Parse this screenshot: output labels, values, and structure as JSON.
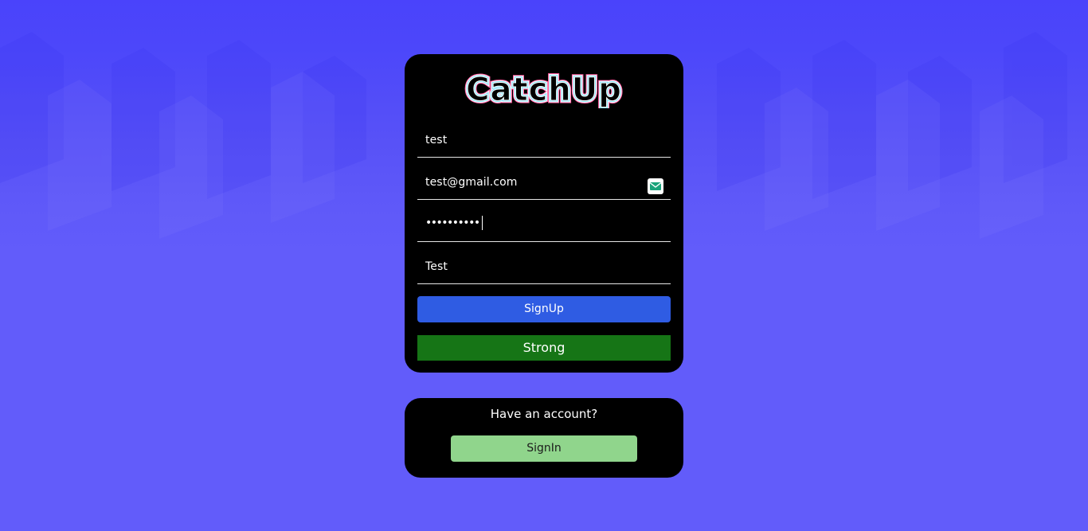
{
  "logo": {
    "text": "CatchUp"
  },
  "form": {
    "username_value": "test",
    "email_value": "test@gmail.com",
    "password_masked": "••••••••••",
    "name_value": "Test",
    "signup_label": "SignUp",
    "strength_label": "Strong"
  },
  "signin": {
    "prompt": "Have an account?",
    "button_label": "SignIn"
  },
  "colors": {
    "background": "#625bf9",
    "card": "#000000",
    "signup_button": "#2f5ce3",
    "strength_strong": "#167516",
    "signin_button": "#90d58c",
    "mail_icon": "#1aa37a"
  },
  "icons": {
    "email_field": "mail-icon"
  }
}
